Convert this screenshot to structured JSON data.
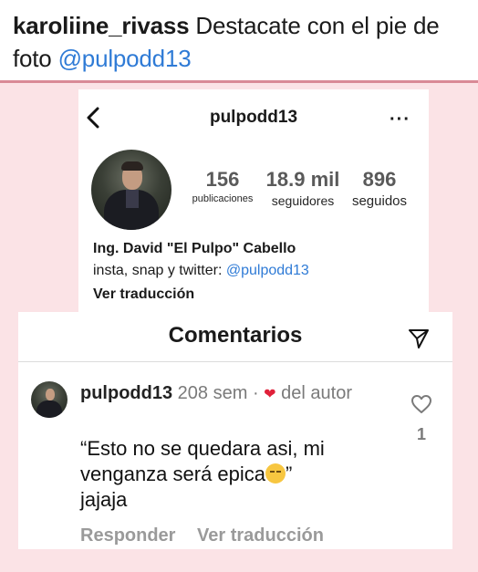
{
  "caption": {
    "username": "karoliine_rivass",
    "text": "Destacate con el pie de foto",
    "mention": "@pulpodd13"
  },
  "profile": {
    "handle": "pulpodd13",
    "more_label": "···",
    "stats": {
      "posts": {
        "value": "156",
        "label": "publicaciones"
      },
      "followers": {
        "value": "18.9 mil",
        "label": "seguidores"
      },
      "following": {
        "value": "896",
        "label": "seguidos"
      }
    },
    "bio_name": "Ing. David \"El Pulpo\" Cabello",
    "bio_text": "insta, snap y twitter:",
    "bio_link": "@pulpodd13",
    "see_translation": "Ver traducción"
  },
  "comments": {
    "title": "Comentarios",
    "items": [
      {
        "username": "pulpodd13",
        "meta": "208 sem ·",
        "author_tag": "del autor",
        "text_before_emoji": "“Esto no se quedara asi, mi venganza será epica",
        "text_after_emoji": "”",
        "text_last_line": "jajaja",
        "reply_label": "Responder",
        "translate_label": "Ver traducción",
        "like_count": "1"
      }
    ]
  },
  "colors": {
    "background": "#fbe3e6",
    "mention": "#2f7bd6",
    "heart": "#e0213a"
  }
}
